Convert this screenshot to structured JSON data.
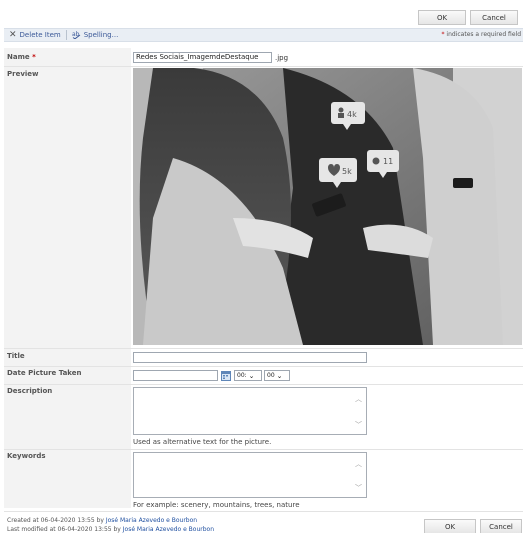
{
  "buttons": {
    "ok": "OK",
    "cancel": "Cancel"
  },
  "toolbar": {
    "delete_label": "Delete Item",
    "spelling_label": "Spelling...",
    "required_note_star": "*",
    "required_note": " indicates a required field"
  },
  "fields": {
    "name": {
      "label": "Name",
      "required_star": "*",
      "value": "Redes Sociais_ImagemdeDestaque",
      "extension": ".jpg"
    },
    "preview": {
      "label": "Preview",
      "badges": [
        "4k",
        "5k",
        "11"
      ]
    },
    "title": {
      "label": "Title",
      "value": ""
    },
    "date_taken": {
      "label": "Date Picture Taken",
      "date": "",
      "hour": "00:",
      "minute": "00"
    },
    "description": {
      "label": "Description",
      "value": "",
      "hint": "Used as alternative text for the picture."
    },
    "keywords": {
      "label": "Keywords",
      "value": "",
      "hint": "For example: scenery, mountains, trees, nature"
    }
  },
  "footer": {
    "created_prefix": "Created at 06-04-2020 13:55  by ",
    "created_by": "José Maria Azevedo e Bourbon",
    "modified_prefix": "Last modified at 06-04-2020 13:55  by ",
    "modified_by": "José Maria Azevedo e Bourbon"
  },
  "colors": {
    "required": "#c00000",
    "link": "#2050a0",
    "toolbar_bg": "#e9eef4"
  },
  "icons": {
    "delete": "x-icon",
    "spelling": "spellcheck-icon",
    "calendar": "calendar-icon"
  }
}
